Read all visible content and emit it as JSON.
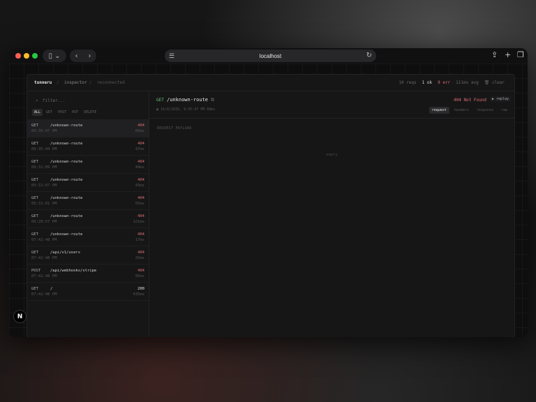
{
  "browser": {
    "url": "localhost"
  },
  "app": {
    "brand": "tunneru",
    "breadcrumb": [
      "inspector",
      "reconnected"
    ],
    "stats": {
      "reqs": "10 reqs",
      "ok": "1 ok",
      "err": "9 err",
      "avg": "111ms avg"
    },
    "clear_label": "clear"
  },
  "sidebar": {
    "filter_placeholder": "filter...",
    "methods": [
      "ALL",
      "GET",
      "POST",
      "PUT",
      "DELETE"
    ],
    "active_method": "ALL",
    "requests": [
      {
        "method": "GET",
        "path": "/unknown-route",
        "status": "404",
        "time": "09:35:47 PM",
        "duration": "60ms"
      },
      {
        "method": "GET",
        "path": "/unknown-route",
        "status": "404",
        "time": "09:35:44 PM",
        "duration": "47ms"
      },
      {
        "method": "GET",
        "path": "/unknown-route",
        "status": "404",
        "time": "09:31:09 PM",
        "duration": "44ms"
      },
      {
        "method": "GET",
        "path": "/unknown-route",
        "status": "404",
        "time": "09:31:07 PM",
        "duration": "43ms"
      },
      {
        "method": "GET",
        "path": "/unknown-route",
        "status": "404",
        "time": "09:31:01 PM",
        "duration": "55ms"
      },
      {
        "method": "GET",
        "path": "/unknown-route",
        "status": "404",
        "time": "09:28:57 PM",
        "duration": "121ms"
      },
      {
        "method": "GET",
        "path": "/unknown-route",
        "status": "404",
        "time": "07:42:48 PM",
        "duration": "17ms"
      },
      {
        "method": "GET",
        "path": "/api/v1/users",
        "status": "404",
        "time": "07:42:48 PM",
        "duration": "25ms"
      },
      {
        "method": "POST",
        "path": "/api/webhooks/stripe",
        "status": "404",
        "time": "07:42:48 PM",
        "duration": "95ms"
      },
      {
        "method": "GET",
        "path": "/",
        "status": "200",
        "time": "07:42:48 PM",
        "duration": "435ms"
      }
    ]
  },
  "detail": {
    "method": "GET",
    "path": "/unknown-route",
    "status": "404 Not Found",
    "replay_label": "replay",
    "meta": "16/8/2026, 9:35:47 PM  60ms",
    "tabs": [
      "request",
      "headers",
      "response",
      "raw"
    ],
    "active_tab": "request",
    "payload_label": "REQUEST PAYLOAD",
    "empty_text": "empty"
  },
  "badge": "N"
}
